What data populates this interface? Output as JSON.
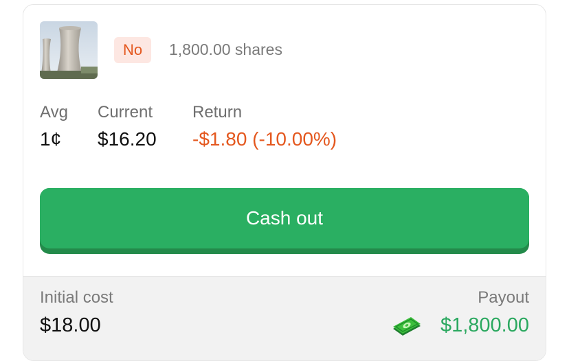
{
  "position": {
    "side": "No",
    "shares": "1,800.00 shares",
    "image_icon": "cooling-towers-image"
  },
  "stats": {
    "avg_label": "Avg",
    "avg_value": "1¢",
    "current_label": "Current",
    "current_value": "$16.20",
    "return_label": "Return",
    "return_value": "-$1.80 (-10.00%)"
  },
  "actions": {
    "cash_out_label": "Cash out"
  },
  "footer": {
    "initial_cost_label": "Initial cost",
    "initial_cost_value": "$18.00",
    "payout_label": "Payout",
    "payout_value": "$1,800.00",
    "payout_icon": "money-icon"
  },
  "colors": {
    "accent_green": "#2aaf62",
    "negative_orange": "#e4581f",
    "badge_bg": "#fde7e2"
  }
}
